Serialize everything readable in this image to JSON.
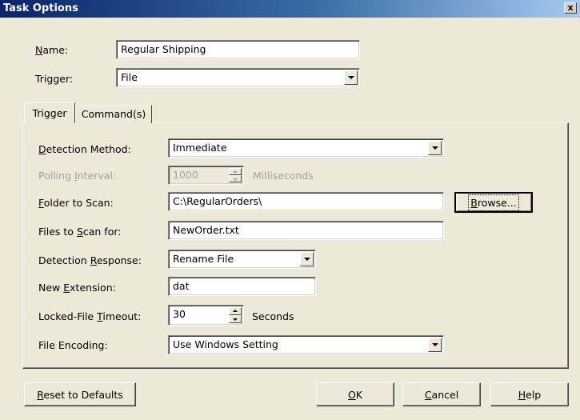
{
  "window": {
    "title": "Task Options",
    "close_glyph": "x"
  },
  "name": {
    "label_pre": "",
    "label_key": "N",
    "label_post": "ame:",
    "value": "Regular Shipping"
  },
  "trigger_field": {
    "label_pre": "Tri",
    "label_key": "g",
    "label_post": "ger:",
    "value": "File"
  },
  "tabs": [
    {
      "label": "Trigger"
    },
    {
      "label": "Command(s)"
    }
  ],
  "detection_method": {
    "label_pre": "",
    "label_key": "D",
    "label_post": "etection Method:",
    "value": "Immediate"
  },
  "polling_interval": {
    "label_pre": "Polling ",
    "label_key": "I",
    "label_post": "nterval:",
    "value": "1000",
    "unit": "Milliseconds"
  },
  "folder_to_scan": {
    "label_pre": "",
    "label_key": "F",
    "label_post": "older to Scan:",
    "value": "C:\\RegularOrders\\"
  },
  "browse_button": {
    "label_pre": "",
    "label_key": "B",
    "label_post": "rowse..."
  },
  "files_to_scan": {
    "label_pre": "Files to ",
    "label_key": "S",
    "label_post": "can for:",
    "value": "NewOrder.txt"
  },
  "detection_response": {
    "label_pre": "Detection ",
    "label_key": "R",
    "label_post": "esponse:",
    "value": "Rename File"
  },
  "new_extension": {
    "label_pre": "New ",
    "label_key": "E",
    "label_post": "xtension:",
    "value": "dat"
  },
  "locked_file_timeout": {
    "label_pre": "Locked-File ",
    "label_key": "T",
    "label_post": "imeout:",
    "value": "30",
    "unit": "Seconds"
  },
  "file_encoding": {
    "label": "File Encoding:",
    "value": "Use Windows Setting"
  },
  "buttons": {
    "reset": {
      "pre": "",
      "key": "R",
      "post": "eset to Defaults"
    },
    "ok": {
      "pre": "",
      "key": "O",
      "post": "K"
    },
    "cancel": {
      "pre": "",
      "key": "C",
      "post": "ancel"
    },
    "help": {
      "pre": "",
      "key": "H",
      "post": "elp"
    }
  },
  "colors": {
    "face": "#ece9d8",
    "title_start": "#0a246a",
    "title_end": "#a6caf0",
    "disabled_text": "#a0a0a0"
  }
}
